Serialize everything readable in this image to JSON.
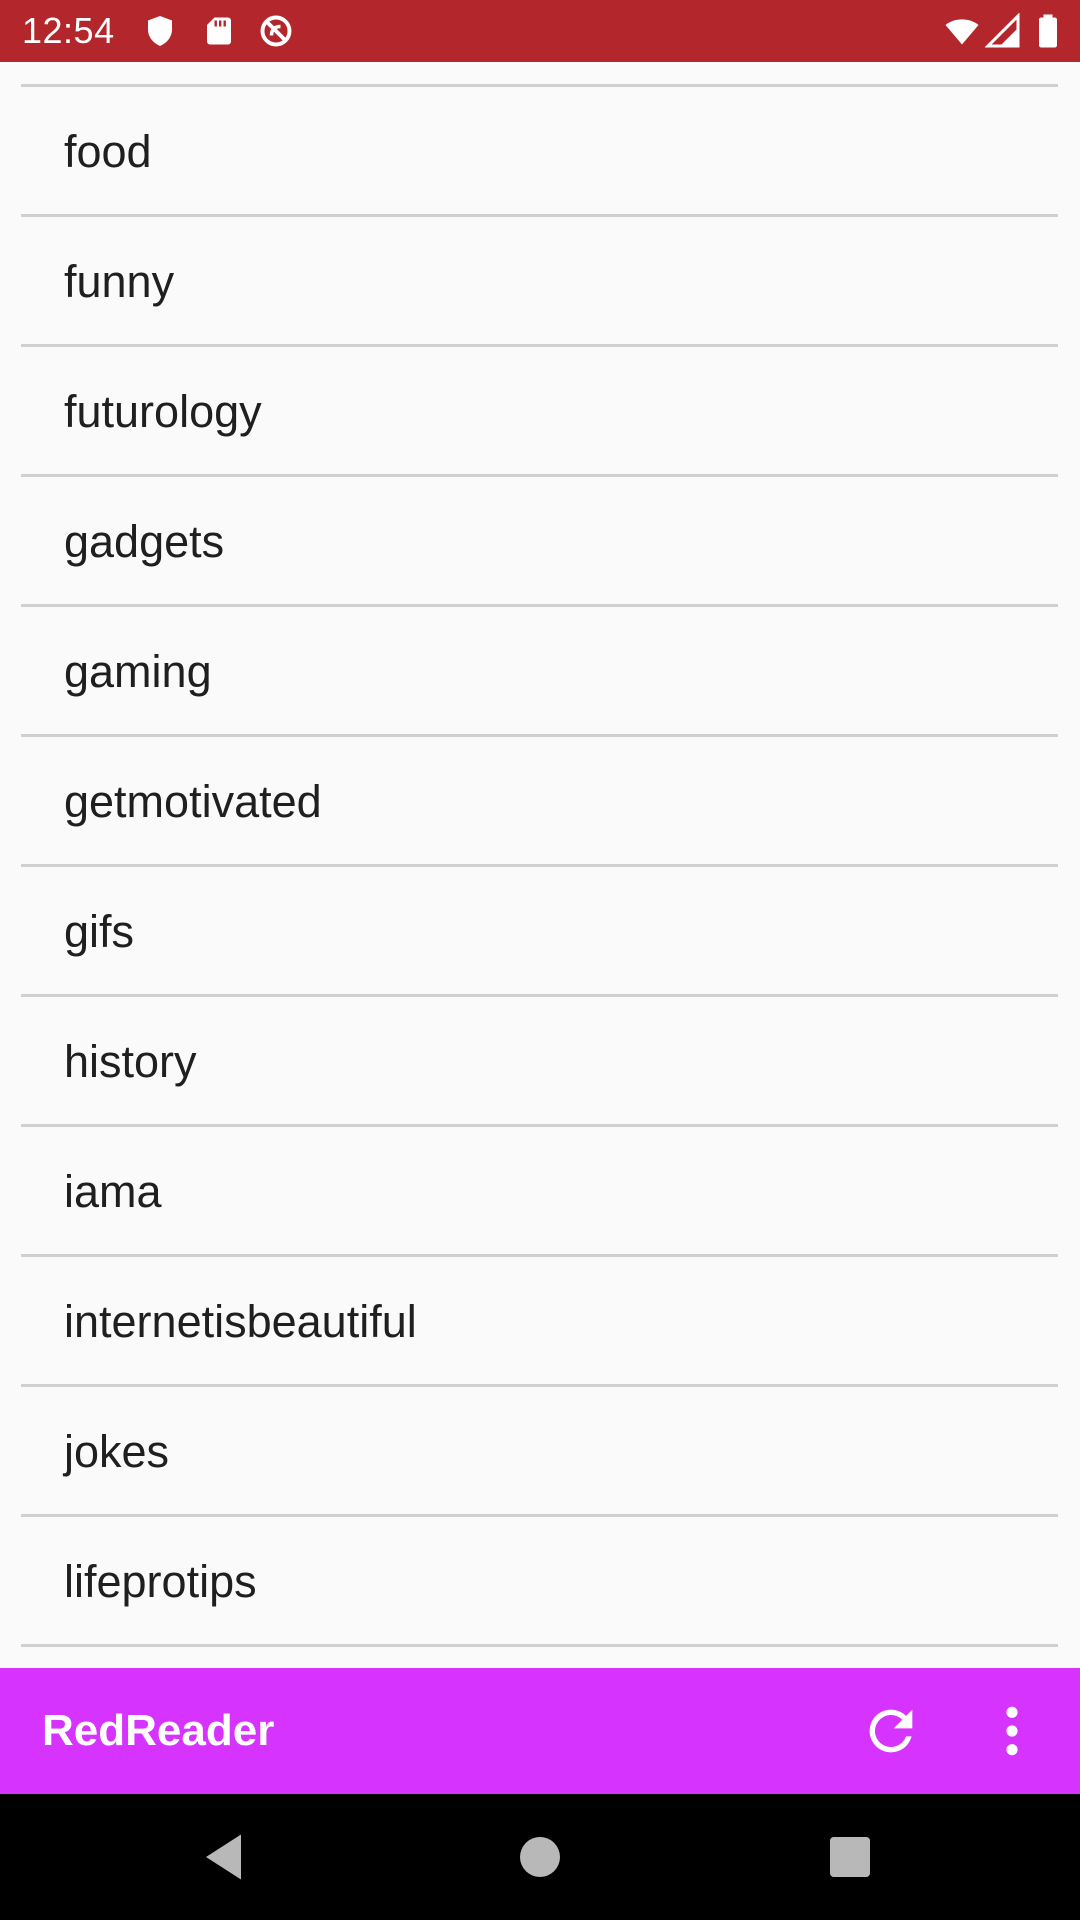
{
  "status_bar": {
    "time": "12:54",
    "left_icons": [
      "shield-icon",
      "sd-card-icon",
      "no-sync-icon"
    ],
    "right_icons": [
      "wifi-icon",
      "cell-signal-icon",
      "battery-icon"
    ],
    "background_color": "#b3262b"
  },
  "subreddit_list": {
    "items": [
      {
        "label": "food"
      },
      {
        "label": "funny"
      },
      {
        "label": "futurology"
      },
      {
        "label": "gadgets"
      },
      {
        "label": "gaming"
      },
      {
        "label": "getmotivated"
      },
      {
        "label": "gifs"
      },
      {
        "label": "history"
      },
      {
        "label": "iama"
      },
      {
        "label": "internetisbeautiful"
      },
      {
        "label": "jokes"
      },
      {
        "label": "lifeprotips"
      }
    ]
  },
  "app_bar": {
    "title": "RedReader",
    "refresh_icon": "refresh-icon",
    "menu_icon": "more-vert-icon",
    "background_color": "#d633ff"
  },
  "nav_bar": {
    "buttons": [
      "back-icon",
      "home-icon",
      "recents-icon"
    ]
  }
}
